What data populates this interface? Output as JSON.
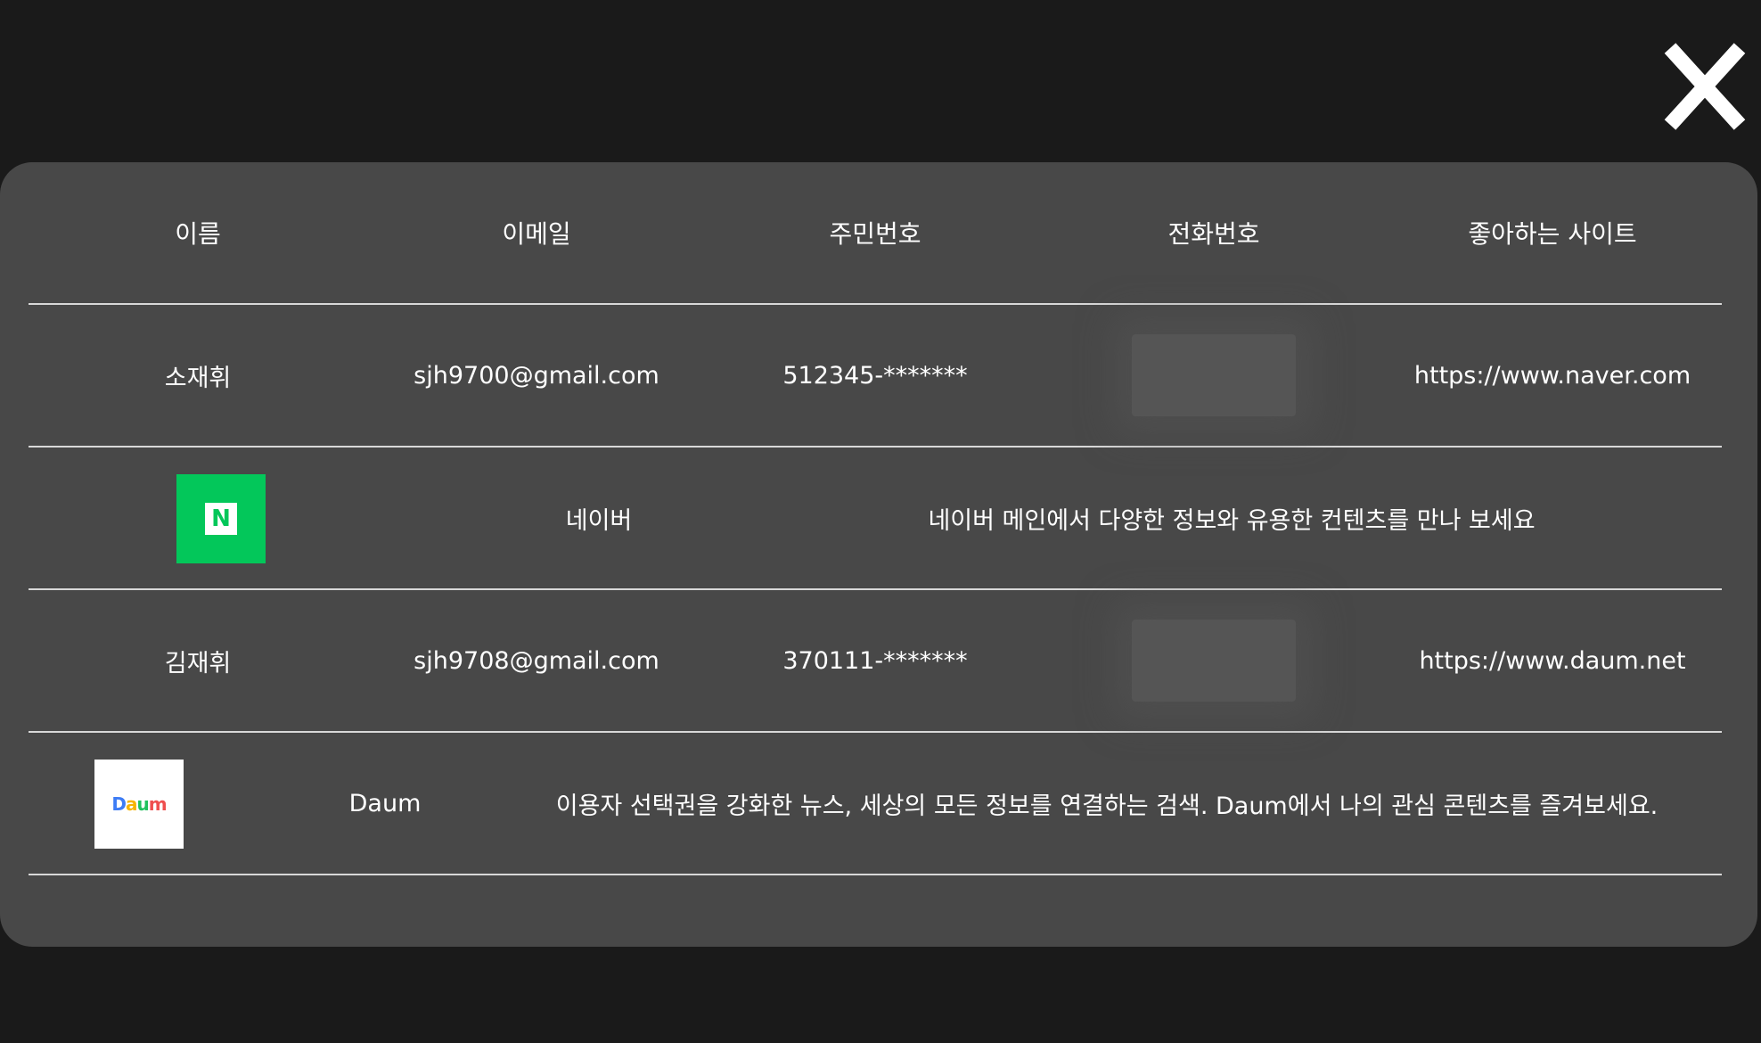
{
  "close_label": "X",
  "table": {
    "headers": [
      "이름",
      "이메일",
      "주민번호",
      "전화번호",
      "좋아하는 사이트"
    ],
    "rows": [
      {
        "name": "소재휘",
        "email": "sjh9700@gmail.com",
        "rrn": "512345-*******",
        "site": "https://www.naver.com"
      },
      {
        "name": "김재휘",
        "email": "sjh9708@gmail.com",
        "rrn": "370111-*******",
        "site": "https://www.daum.net"
      }
    ],
    "sites": [
      {
        "name": "네이버",
        "logo_text": "N",
        "description": "네이버 메인에서 다양한 정보와 유용한 컨텐츠를 만나 보세요"
      },
      {
        "name": "Daum",
        "logo_text": [
          "D",
          "a",
          "u",
          "m"
        ],
        "description": "이용자 선택권을 강화한 뉴스, 세상의 모든 정보를 연결하는 검색. Daum에서 나의 관심 콘텐츠를 즐겨보세요."
      }
    ]
  },
  "colors": {
    "background": "#1a1a1a",
    "panel": "#484848",
    "divider": "#d8d8d8",
    "naver_green": "#03c75a",
    "text": "#ffffff"
  },
  "icons": {
    "close": "close-x-icon",
    "naver": "naver-logo",
    "daum": "daum-logo",
    "phone_hidden": "blurred-placeholder"
  }
}
